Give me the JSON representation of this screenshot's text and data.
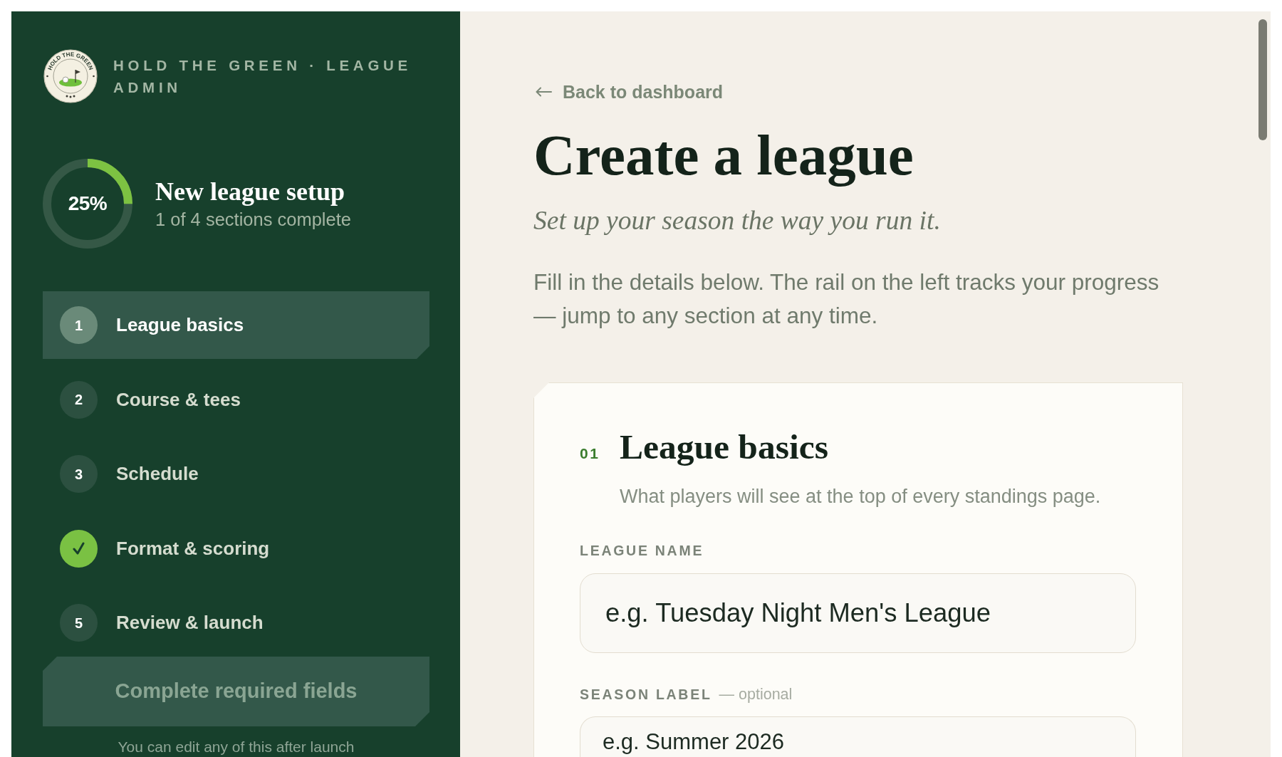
{
  "sidebar": {
    "brand": {
      "logo_text": "HOLD THE GREEN",
      "name": "HOLD THE GREEN · LEAGUE ADMIN"
    },
    "progress": {
      "level": 0.25,
      "reading": "25%",
      "title": "New league setup",
      "subtitle": "1 of 4 sections complete"
    },
    "steps": [
      {
        "number": "1",
        "label": "League basics",
        "selected": true,
        "complete": false
      },
      {
        "number": "2",
        "label": "Course & tees",
        "selected": false,
        "complete": false
      },
      {
        "number": "3",
        "label": "Schedule",
        "selected": false,
        "complete": false
      },
      {
        "label": "Format & scoring",
        "selected": false,
        "complete": true
      },
      {
        "number": "5",
        "label": "Review & launch",
        "selected": false,
        "complete": false
      }
    ],
    "submit_button": {
      "label": "Complete required fields",
      "disabled": true
    },
    "note": "You can edit any of this after launch"
  },
  "main": {
    "back_link": "Back to dashboard",
    "title": "Create a league",
    "subtitle": "Set up your season the way you run it.",
    "intro": "Fill in the details below. The rail on the left tracks your progress — jump to any section at any time.",
    "section": {
      "number": "01",
      "title": "League basics",
      "description": "What players will see at the top of every standings page.",
      "fields": [
        {
          "label": "LEAGUE NAME",
          "placeholder": "e.g. Tuesday Night Men's League"
        },
        {
          "label": "SEASON LABEL",
          "hint": "— optional",
          "placeholder": "e.g. Summer 2026"
        }
      ]
    }
  }
}
